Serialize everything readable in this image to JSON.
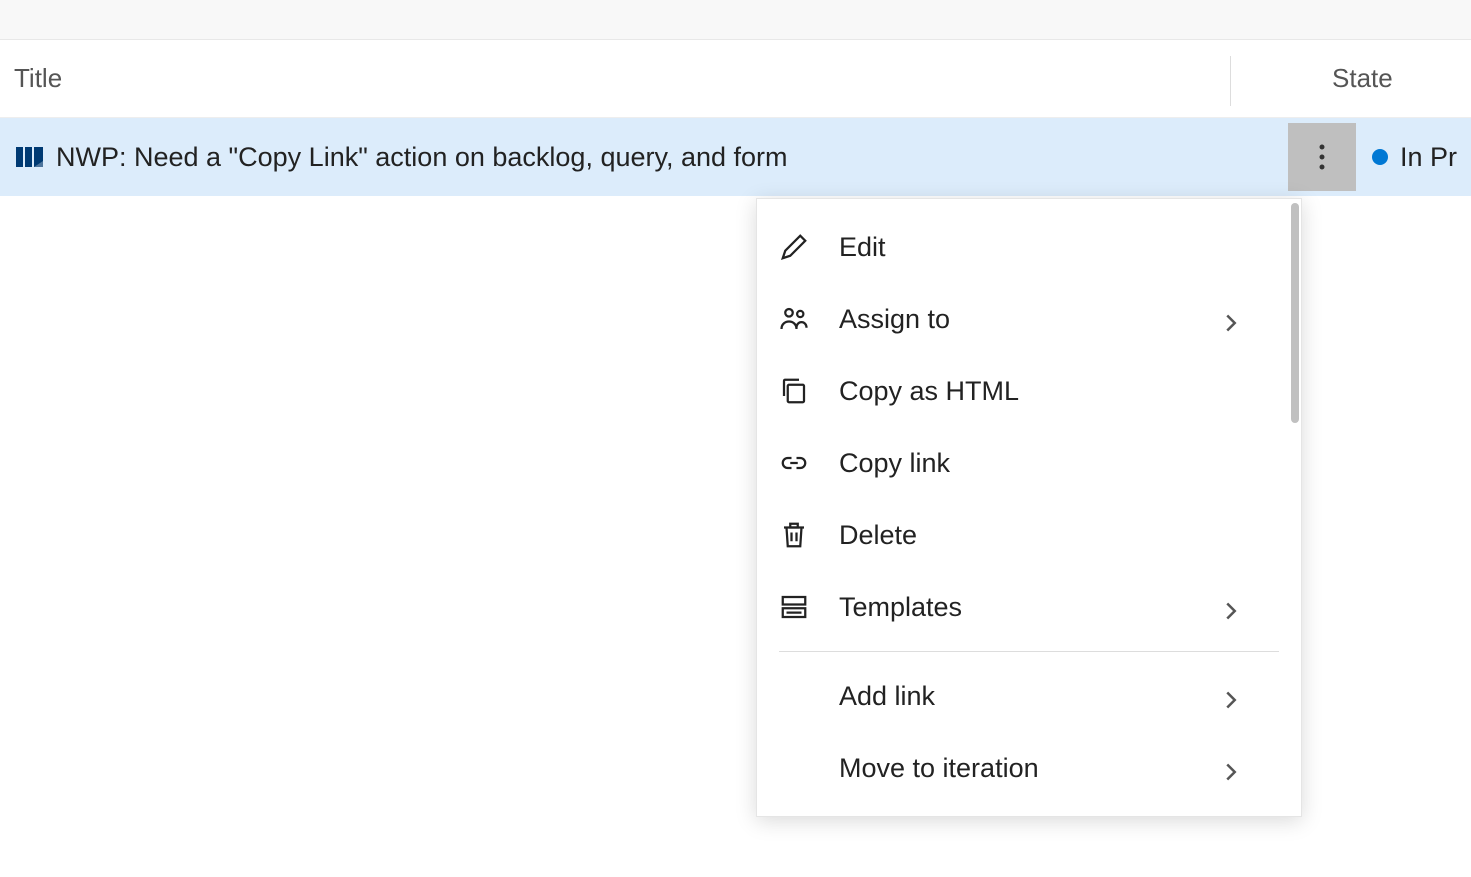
{
  "header": {
    "title_label": "Title",
    "state_label": "State"
  },
  "item": {
    "title": "NWP: Need a \"Copy Link\" action on backlog, query, and form",
    "state": "In Pr",
    "state_color": "#0078d4"
  },
  "menu": {
    "items": [
      {
        "id": "edit",
        "label": "Edit",
        "icon": "pencil",
        "submenu": false
      },
      {
        "id": "assign-to",
        "label": "Assign to",
        "icon": "people",
        "submenu": true
      },
      {
        "id": "copy-html",
        "label": "Copy as HTML",
        "icon": "copy",
        "submenu": false
      },
      {
        "id": "copy-link",
        "label": "Copy link",
        "icon": "link",
        "submenu": false,
        "highlighted": true
      },
      {
        "id": "delete",
        "label": "Delete",
        "icon": "trash",
        "submenu": false
      },
      {
        "id": "templates",
        "label": "Templates",
        "icon": "template",
        "submenu": true
      },
      {
        "id": "divider",
        "divider": true
      },
      {
        "id": "add-link",
        "label": "Add link",
        "icon": "",
        "submenu": true
      },
      {
        "id": "move-iteration",
        "label": "Move to iteration",
        "icon": "",
        "submenu": true
      }
    ]
  }
}
